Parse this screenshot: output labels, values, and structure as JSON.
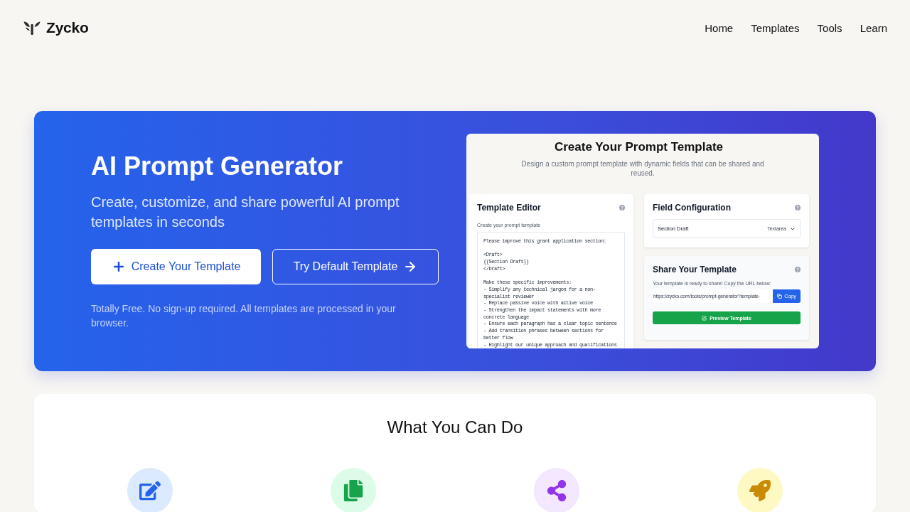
{
  "header": {
    "logo": "Zycko",
    "nav": [
      {
        "label": "Home"
      },
      {
        "label": "Templates"
      },
      {
        "label": "Tools"
      },
      {
        "label": "Learn"
      }
    ]
  },
  "hero": {
    "title": "AI Prompt Generator",
    "subtitle": "Create, customize, and share powerful AI prompt templates in seconds",
    "buttons": [
      {
        "label": "Create Your Template",
        "kind": "primary"
      },
      {
        "label": "Try Default Template",
        "kind": "outline"
      }
    ],
    "note": "Totally Free. No sign-up required. All templates are processed in your browser."
  },
  "preview": {
    "title": "Create Your Prompt Template",
    "subtitle": "Design a custom prompt template with dynamic fields that can be shared and reused.",
    "editor": {
      "title": "Template Editor",
      "label": "Create your prompt template",
      "value": "Please improve this grant application section:\n\n<Draft>\n{{Section Draft}}\n</Draft>\n\nMake these specific improvements:\n- Simplify any technical jargon for a non-specialist reviewer\n- Replace passive voice with active voice\n- Strengthen the impact statements with more concrete language\n- Ensure each paragraph has a clear topic sentence\n- Add transition phrases between sections for better flow\n- Highlight our unique approach and qualifications"
    },
    "fields": {
      "title": "Field Configuration",
      "items": [
        {
          "name": "Section Draft",
          "type": "Textarea"
        }
      ]
    },
    "share": {
      "title": "Share Your Template",
      "text": "Your template is ready to share! Copy the URL below:",
      "url": "https://zycko.com/tools/prompt-generator?template-",
      "copy_button": "Copy",
      "preview_button": "Preview Template"
    }
  },
  "features": {
    "title": "What You Can Do",
    "items": [
      {
        "kind": "edit"
      },
      {
        "kind": "copy"
      },
      {
        "kind": "share"
      },
      {
        "kind": "rocket"
      }
    ]
  }
}
